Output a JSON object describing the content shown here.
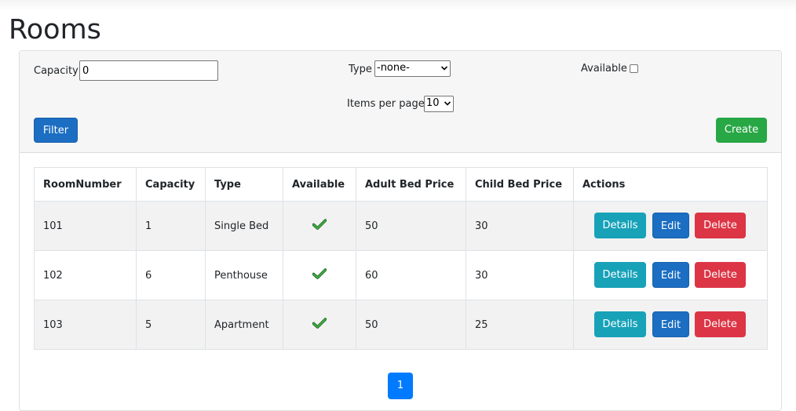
{
  "page": {
    "title": "Rooms"
  },
  "filters": {
    "capacity_label": "Capacity",
    "capacity_value": "0",
    "type_label": "Type",
    "type_selected": "-none-",
    "available_label": "Available",
    "available_checked": false,
    "items_per_page_label": "Items per page:",
    "items_per_page_selected": "10",
    "filter_button": "Filter",
    "create_button": "Create"
  },
  "table": {
    "headers": [
      "RoomNumber",
      "Capacity",
      "Type",
      "Available",
      "Adult Bed Price",
      "Child Bed Price",
      "Actions"
    ],
    "rows": [
      {
        "room_number": "101",
        "capacity": "1",
        "type": "Single Bed",
        "available": true,
        "adult_bed_price": "50",
        "child_bed_price": "30"
      },
      {
        "room_number": "102",
        "capacity": "6",
        "type": "Penthouse",
        "available": true,
        "adult_bed_price": "60",
        "child_bed_price": "30"
      },
      {
        "room_number": "103",
        "capacity": "5",
        "type": "Apartment",
        "available": true,
        "adult_bed_price": "50",
        "child_bed_price": "25"
      }
    ],
    "row_actions": {
      "details": "Details",
      "edit": "Edit",
      "delete": "Delete"
    }
  },
  "pagination": {
    "current_page": "1"
  },
  "icons": {
    "available_true": "check-icon"
  },
  "colors": {
    "primary_blue": "#1b6ec2",
    "create_green": "#28a745",
    "details_teal": "#17a2b8",
    "delete_red": "#dc3545",
    "pagination_blue": "#007bff",
    "check_green": "#2e9e2e"
  }
}
